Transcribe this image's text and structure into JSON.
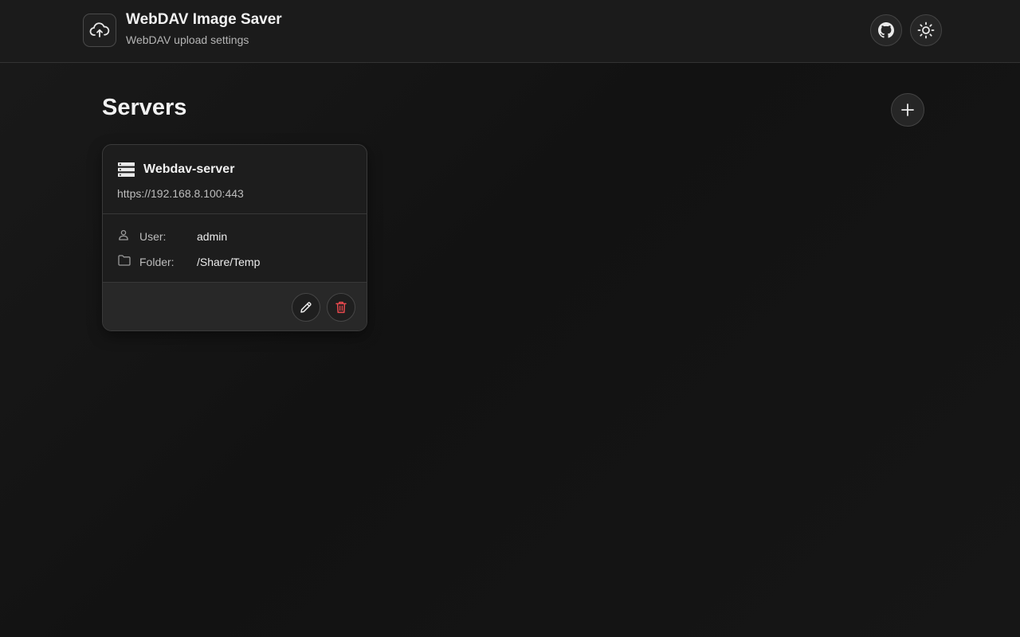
{
  "header": {
    "title": "WebDAV Image Saver",
    "subtitle": "WebDAV upload settings",
    "logo_icon": "cloud-upload-icon",
    "github_icon": "github-icon",
    "theme_icon": "sun-icon"
  },
  "main": {
    "section_title": "Servers",
    "add_icon": "plus-icon",
    "servers": [
      {
        "name": "Webdav-server",
        "url": "https://192.168.8.100:443",
        "user_label": "User:",
        "user": "admin",
        "folder_label": "Folder:",
        "folder": "/Share/Temp",
        "icons": {
          "server": "server-icon",
          "user": "user-icon",
          "folder": "folder-icon",
          "edit": "pencil-icon",
          "delete": "trash-icon"
        }
      }
    ]
  },
  "colors": {
    "background": "#141414",
    "header_bg": "#1b1b1b",
    "card_bg": "#1d1d1d",
    "card_footer_bg": "#282828",
    "text_primary": "#f2f2f2",
    "text_secondary": "#bcbcbc",
    "danger": "#e5484d"
  }
}
